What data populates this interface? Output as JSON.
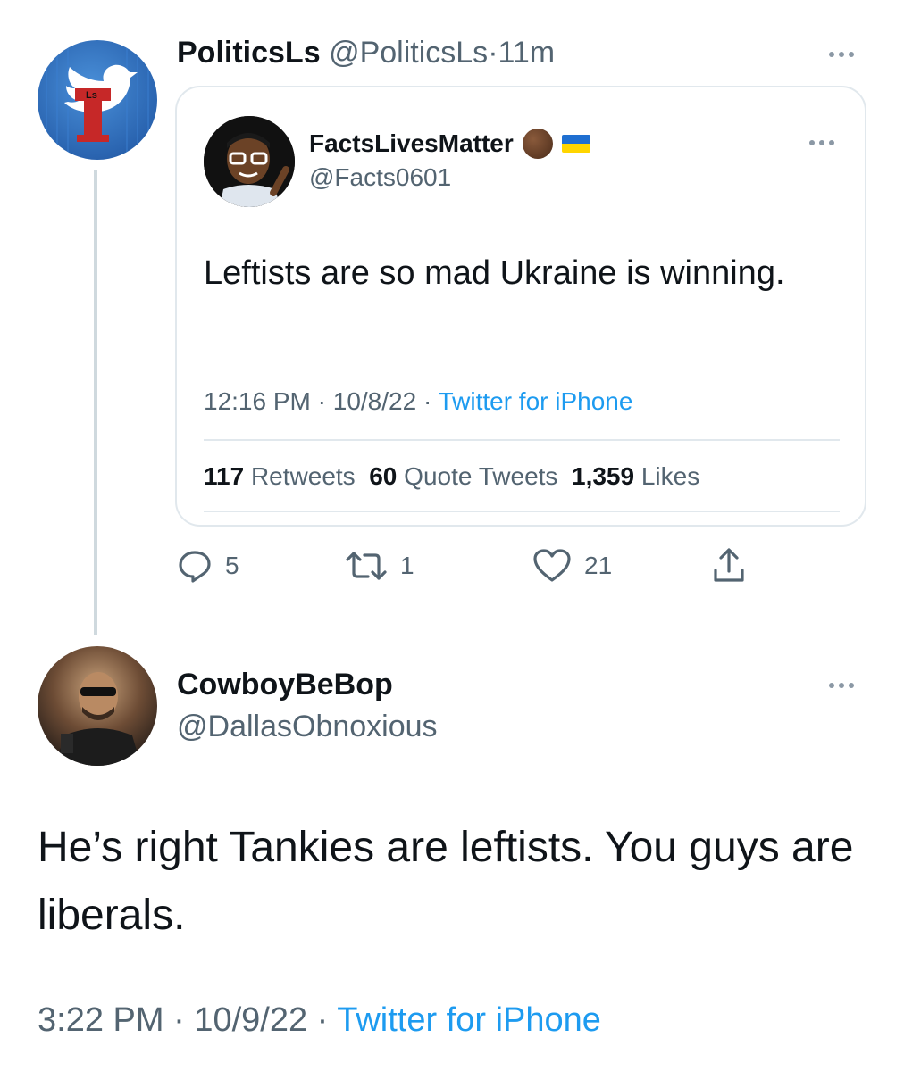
{
  "top_tweet": {
    "display_name": "PoliticsLs",
    "handle": "@PoliticsLs",
    "separator": "·",
    "time_ago": "11m",
    "avatar_label": "Ls",
    "more_icon": "ellipsis-icon"
  },
  "quote": {
    "display_name": "FactsLivesMatter",
    "handle": "@Facts0601",
    "emoji": [
      "brown-circle-emoji",
      "ukraine-flag-emoji"
    ],
    "text": "Leftists are so mad Ukraine is winning.",
    "time": "12:16 PM",
    "date": "10/8/22",
    "separator": "·",
    "source": "Twitter for iPhone",
    "stats": {
      "retweets_count": "117",
      "retweets_label": "Retweets",
      "quotes_count": "60",
      "quotes_label": "Quote Tweets",
      "likes_count": "1,359",
      "likes_label": "Likes"
    }
  },
  "actions": {
    "reply_count": "5",
    "retweet_count": "1",
    "like_count": "21"
  },
  "reply_tweet": {
    "display_name": "CowboyBeBop",
    "handle": "@DallasObnoxious",
    "text": "He’s right Tankies are leftists. You guys are liberals.",
    "time": "3:22 PM",
    "date": "10/9/22",
    "separator": "·",
    "source": "Twitter for iPhone"
  },
  "colors": {
    "text": "#0f1419",
    "muted": "#536471",
    "link": "#1d9bf0",
    "border": "#e1e8ed",
    "thread_line": "#cfd9de"
  }
}
